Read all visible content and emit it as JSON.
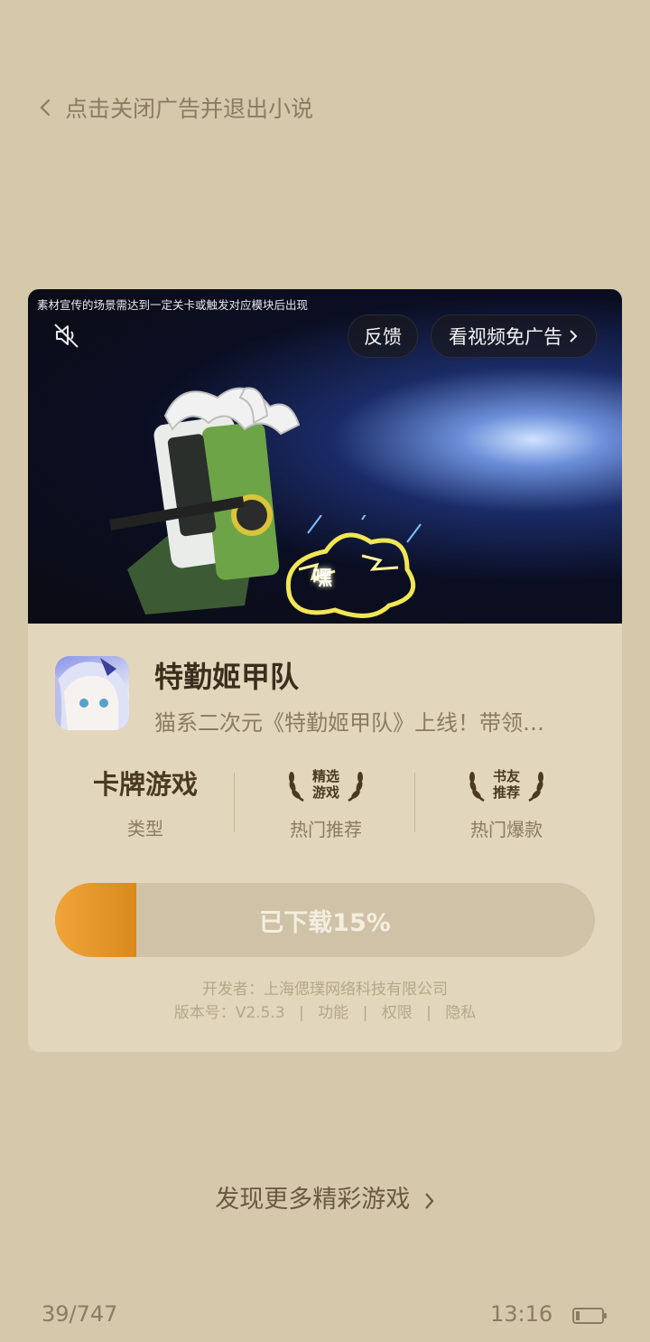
{
  "header": {
    "back_label": "点击关闭广告并退出小说"
  },
  "ad": {
    "video_caption": "素材宣传的场景需达到一定关卡或触发对应模块后出现",
    "feedback_label": "反馈",
    "skip_label": "看视频免广告",
    "video_burst_text": "嘿",
    "app_name": "特勤姬甲队",
    "app_desc": "猫系二次元《特勤姬甲队》上线！带领…",
    "stats": [
      {
        "value": "卡牌游戏",
        "label": "类型"
      },
      {
        "badge": [
          "精选",
          "游戏"
        ],
        "label": "热门推荐"
      },
      {
        "badge": [
          "书友",
          "推荐"
        ],
        "label": "热门爆款"
      }
    ],
    "download_label": "已下载15%",
    "download_progress": 0.15,
    "developer": "开发者：上海偲璞网络科技有限公司",
    "version": "版本号：V2.5.3",
    "links": [
      "功能",
      "权限",
      "隐私"
    ],
    "link_separator": "|"
  },
  "discover_label": "发现更多精彩游戏",
  "status": {
    "reading_progress": "39/747",
    "time": "13:16"
  },
  "colors": {
    "background": "#d6c9ab",
    "card": "#e2d6bc",
    "accent": "#e6952a"
  },
  "icons": [
    "chevron-left-icon",
    "mute-icon",
    "chevron-right-icon",
    "laurel-icon",
    "battery-icon"
  ]
}
